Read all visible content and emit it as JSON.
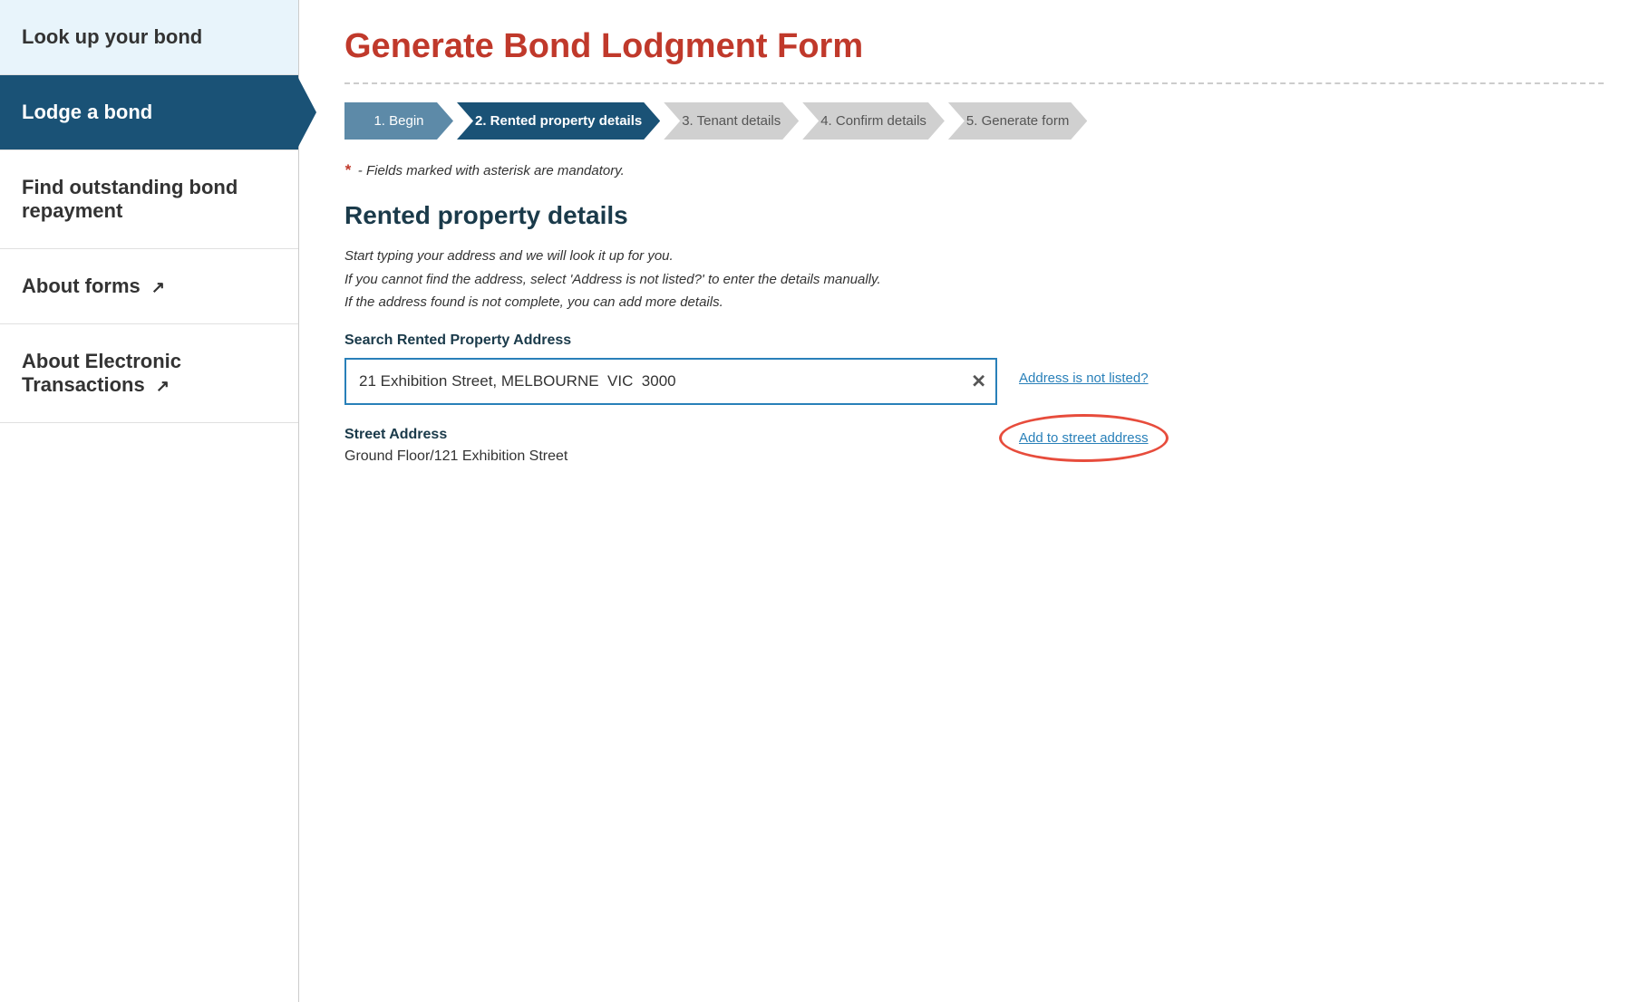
{
  "sidebar": {
    "items": [
      {
        "id": "look-up-bond",
        "label": "Look up your bond",
        "active": false,
        "external": false
      },
      {
        "id": "lodge-bond",
        "label": "Lodge a bond",
        "active": true,
        "external": false
      },
      {
        "id": "find-outstanding",
        "label": "Find outstanding bond repayment",
        "active": false,
        "external": false
      },
      {
        "id": "about-forms",
        "label": "About forms",
        "active": false,
        "external": true
      },
      {
        "id": "about-electronic",
        "label": "About Electronic Transactions",
        "active": false,
        "external": true
      }
    ]
  },
  "main": {
    "page_title": "Generate Bond Lodgment Form",
    "steps": [
      {
        "id": "step-1",
        "label": "1. Begin",
        "state": "completed"
      },
      {
        "id": "step-2",
        "label": "2. Rented property details",
        "state": "active"
      },
      {
        "id": "step-3",
        "label": "3. Tenant details",
        "state": "default"
      },
      {
        "id": "step-4",
        "label": "4. Confirm details",
        "state": "default"
      },
      {
        "id": "step-5",
        "label": "5. Generate form",
        "state": "default"
      }
    ],
    "mandatory_note": "- Fields marked with asterisk are mandatory.",
    "section_title": "Rented property details",
    "description_lines": [
      "Start typing your address and we will look it up for you.",
      "If you cannot find the address, select 'Address is not listed?' to enter the details manually.",
      "If the address found is not complete, you can add more details."
    ],
    "search_label": "Search Rented Property Address",
    "search_value": "21 Exhibition Street, MELBOURNE  VIC  3000",
    "address_not_listed_label": "Address is not listed?",
    "street_address_label": "Street Address",
    "street_address_value": "Ground Floor/121 Exhibition Street",
    "add_to_street_label": "Add to street address",
    "clear_icon": "✕"
  }
}
